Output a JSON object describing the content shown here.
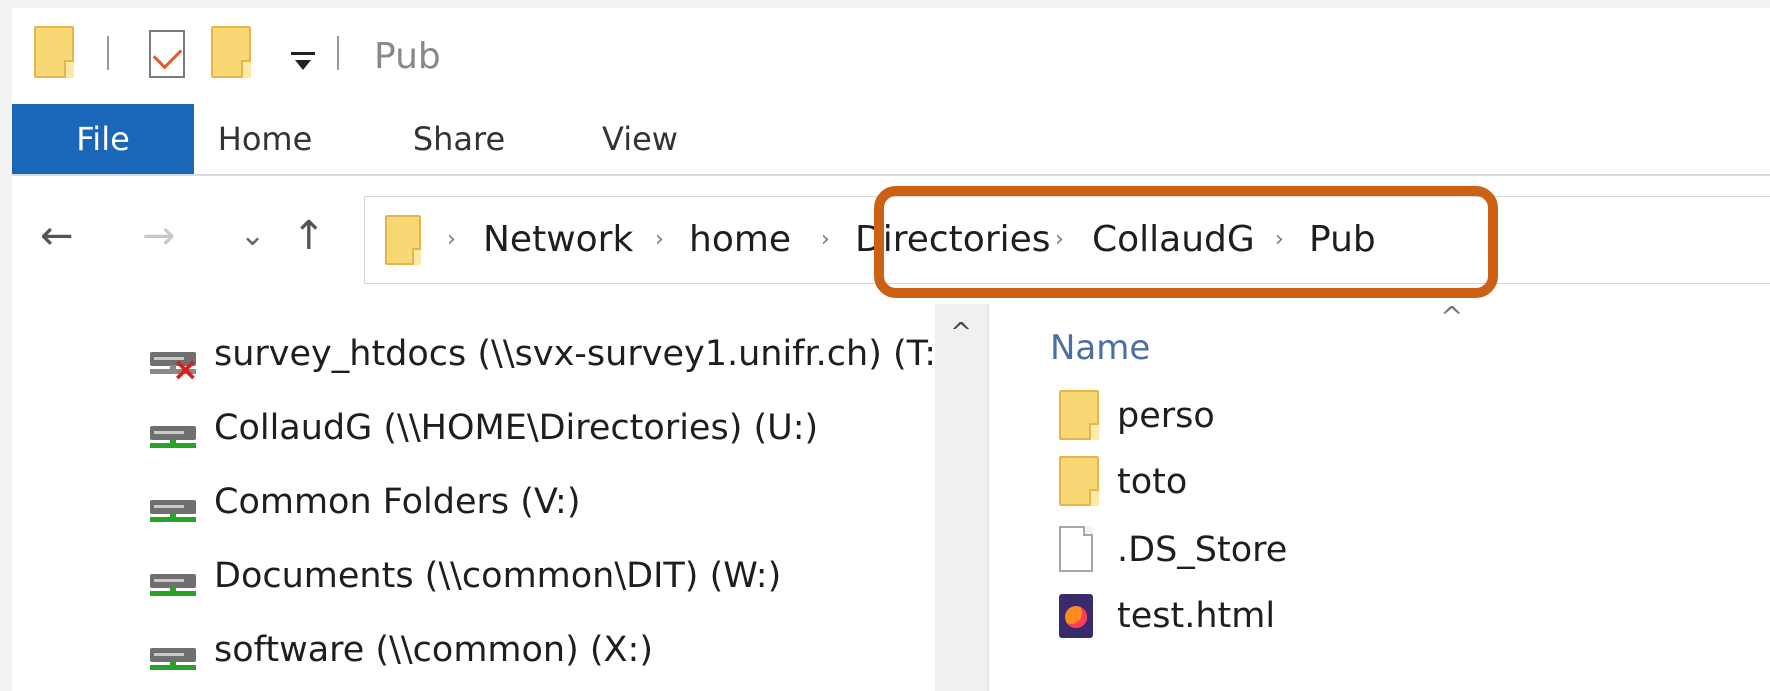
{
  "window": {
    "title": "Pub"
  },
  "ribbon": {
    "tabs": [
      "File",
      "Home",
      "Share",
      "View"
    ]
  },
  "nav": {
    "back_glyph": "←",
    "forward_glyph": "→",
    "recent_glyph": "⌄",
    "up_glyph": "↑"
  },
  "address": {
    "crumbs": [
      "Network",
      "home",
      "Directories",
      "CollaudG",
      "Pub"
    ],
    "separator": "›",
    "highlight_color": "#cc6116"
  },
  "tree": {
    "items": [
      {
        "label": "survey_htdocs (\\\\svx-survey1.unifr.ch) (T:",
        "icon": "disconnected-network-drive-icon"
      },
      {
        "label": "CollaudG (\\\\HOME\\Directories) (U:)",
        "icon": "network-drive-icon"
      },
      {
        "label": "Common Folders (V:)",
        "icon": "network-drive-icon"
      },
      {
        "label": "Documents (\\\\common\\DIT) (W:)",
        "icon": "network-drive-icon"
      },
      {
        "label": "software (\\\\common) (X:)",
        "icon": "network-drive-icon"
      }
    ],
    "scroll_up_glyph": "^"
  },
  "list": {
    "sort_glyph": "^",
    "column_name": "Name",
    "files": [
      {
        "name": "perso",
        "icon": "folder-icon"
      },
      {
        "name": "toto",
        "icon": "folder-icon"
      },
      {
        "name": ".DS_Store",
        "icon": "file-icon"
      },
      {
        "name": "test.html",
        "icon": "firefox-html-icon"
      }
    ]
  },
  "colors": {
    "file_tab": "#1a66b8",
    "folder": "#f8d775",
    "column_header": "#4a6fa5",
    "drive_connected": "#27a327",
    "drive_error": "#d91e1e"
  }
}
